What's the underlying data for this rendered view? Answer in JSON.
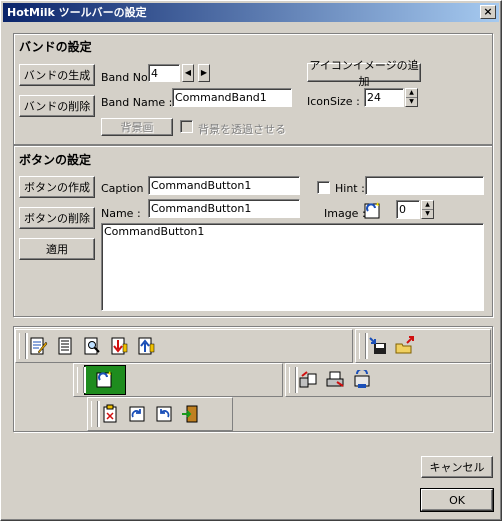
{
  "window": {
    "title": "HotMilk ツールバーの設定",
    "close_label": "×"
  },
  "band_group": {
    "title": "バンドの設定",
    "create_button": "バンドの生成",
    "delete_button": "バンドの削除",
    "band_no_label": "Band No.",
    "band_no_value": "4",
    "band_name_label": "Band Name :",
    "band_name_value": "CommandBand1",
    "background_button": "背景画",
    "transparent_label": "背景を透過させる",
    "add_icon_button": "アイコンイメージの追加",
    "icon_size_label": "IconSize :",
    "icon_size_value": "24"
  },
  "button_group": {
    "title": "ボタンの設定",
    "create_button": "ボタンの作成",
    "delete_button": "ボタンの削除",
    "apply_button": "適用",
    "caption_label": "Caption :",
    "caption_value": "CommandButton1",
    "name_label": "Name :",
    "name_value": "CommandButton1",
    "hint_label": "Hint :",
    "hint_value": "",
    "image_label": "Image :",
    "image_value": "0",
    "text_value": "CommandButton1"
  },
  "footer": {
    "cancel_button": "キャンセル",
    "ok_button": "OK"
  },
  "icons": {
    "band1": [
      "edit-document-icon",
      "document-list-icon",
      "search-document-icon",
      "import-down-icon",
      "export-up-icon"
    ],
    "band2": [
      "refresh-document-icon"
    ],
    "band3": [
      "move-file-icon",
      "print-icon",
      "transfer-icon"
    ],
    "band4": [
      "download-save-icon",
      "open-folder-icon"
    ],
    "band5": [
      "clipboard-icon",
      "redo-icon",
      "undo-icon",
      "exit-door-icon"
    ]
  }
}
